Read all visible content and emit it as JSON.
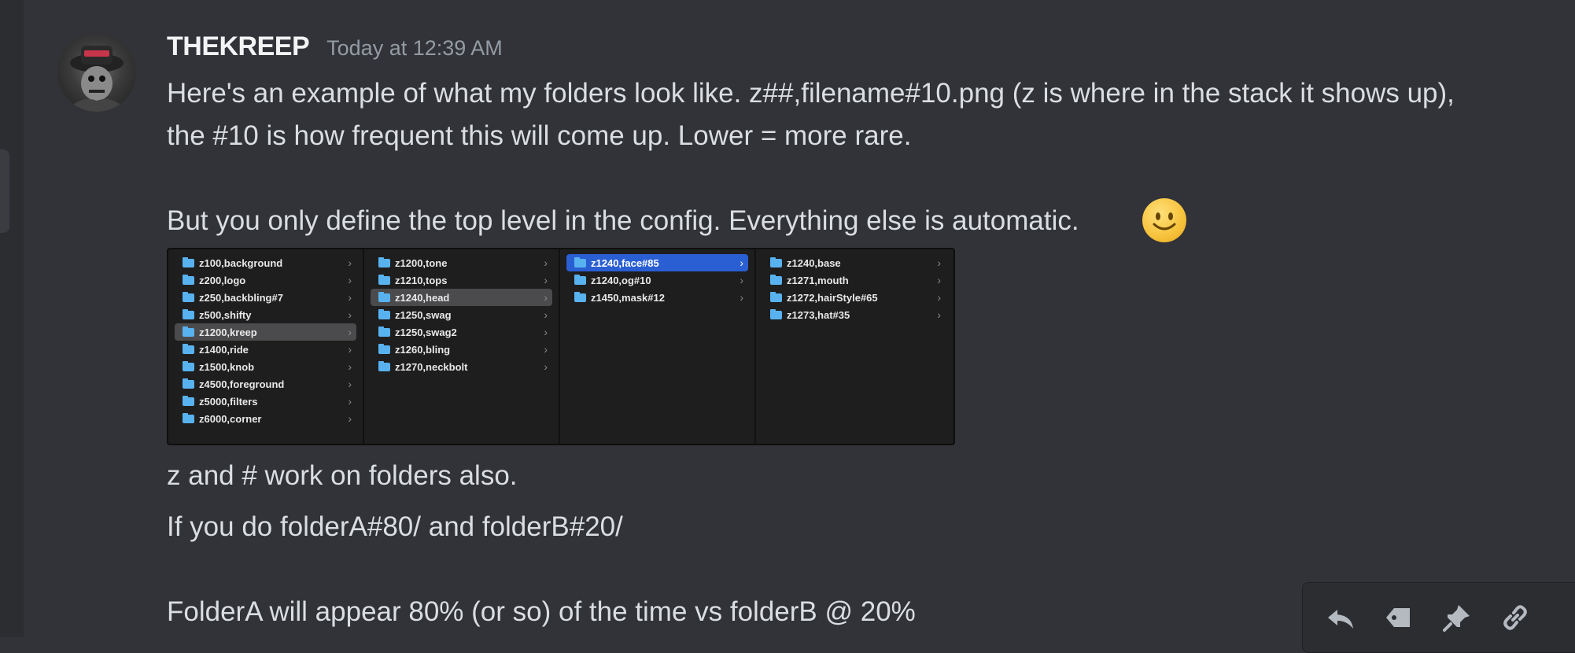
{
  "message": {
    "username": "THEKREEP",
    "timestamp": "Today at 12:39 AM",
    "lines": [
      "Here's an example of what my folders look like. z##,filename#10.png (z is where in the stack it shows up),",
      "the #10 is how frequent this will come up. Lower = more rare.",
      "But you only define the top level in the config. Everything else is automatic.",
      "z and # work on folders also.",
      "If you do folderA#80/ and folderB#20/",
      "FolderA will appear 80% (or so) of the time vs folderB @ 20%"
    ],
    "emoji": "slightly-smiling-face"
  },
  "finder": {
    "columns": [
      {
        "items": [
          "z100,background",
          "z200,logo",
          "z250,backbling#7",
          "z500,shifty",
          "z1200,kreep",
          "z1400,ride",
          "z1500,knob",
          "z4500,foreground",
          "z5000,filters",
          "z6000,corner"
        ],
        "selected": "z1200,kreep"
      },
      {
        "items": [
          "z1200,tone",
          "z1210,tops",
          "z1240,head",
          "z1250,swag",
          "z1250,swag2",
          "z1260,bling",
          "z1270,neckbolt"
        ],
        "selected": "z1240,head"
      },
      {
        "items": [
          "z1240,face#85",
          "z1240,og#10",
          "z1450,mask#12"
        ],
        "selected_active": "z1240,face#85"
      },
      {
        "items": [
          "z1240,base",
          "z1271,mouth",
          "z1272,hairStyle#65",
          "z1273,hat#35"
        ]
      }
    ]
  },
  "toolbar": {
    "icons": [
      "reply-icon",
      "tag-icon",
      "pin-icon",
      "link-icon"
    ]
  },
  "colors": {
    "background": "#313338",
    "text": "#dbdee1",
    "muted": "#949ba4",
    "selection": "#2a5fd3",
    "folder": "#59b2f0"
  }
}
